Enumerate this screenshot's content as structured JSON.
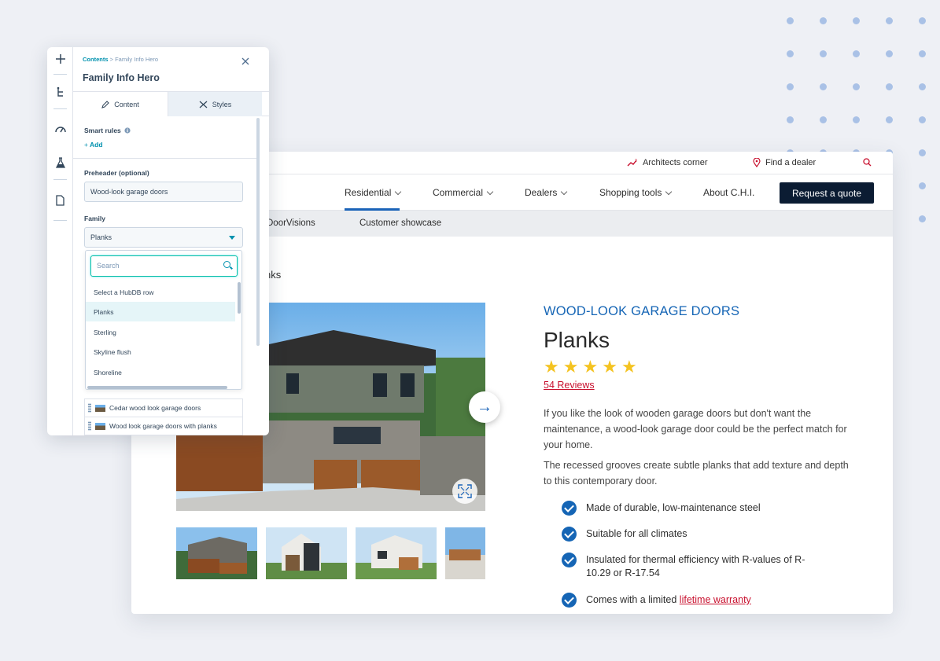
{
  "editor": {
    "breadcrumb_root": "Contents",
    "breadcrumb_sep": ">",
    "breadcrumb_current": "Family Info Hero",
    "title": "Family Info Hero",
    "tabs": [
      {
        "label": "Content"
      },
      {
        "label": "Styles"
      }
    ],
    "smart_rules_label": "Smart rules",
    "add_label": "Add",
    "preheader_label": "Preheader (optional)",
    "preheader_value": "Wood-look garage doors",
    "family_label": "Family",
    "family_value": "Planks",
    "search_placeholder": "Search",
    "options": [
      "Select a HubDB row",
      "Planks",
      "Sterling",
      "Skyline flush",
      "Shoreline"
    ],
    "image_rows": [
      "Cedar wood look garage doors",
      "Wood look garage doors with planks"
    ]
  },
  "site": {
    "util_nav": [
      "Architects corner",
      "Find a dealer"
    ],
    "nav": [
      "Residential",
      "Commercial",
      "Dealers",
      "Shopping tools",
      "About C.H.I."
    ],
    "quote_button": "Request a quote",
    "subnav": [
      "DoorVisions",
      "Customer showcase"
    ],
    "breadcrumb_tail": "nks",
    "product": {
      "eyebrow": "WOOD-LOOK GARAGE DOORS",
      "name": "Planks",
      "rating": 5,
      "reviews": "54 Reviews",
      "para1": "If you like the look of wooden garage doors but don't want the maintenance, a wood-look garage door could be the perfect match for your home.",
      "para2": "The recessed grooves create subtle planks that add texture and depth to this contemporary door.",
      "features": [
        "Made of durable, low-maintenance steel",
        "Suitable for all climates",
        "Insulated for thermal efficiency with R-values of R-10.29 or R-17.54"
      ],
      "feature4_prefix": "Comes with a limited ",
      "feature4_link": "lifetime warranty"
    }
  },
  "colors": {
    "brand_blue": "#1565b5",
    "brand_red": "#c8102e",
    "navy": "#0b1c33",
    "hub_teal": "#0091ae",
    "star": "#f4c321"
  }
}
